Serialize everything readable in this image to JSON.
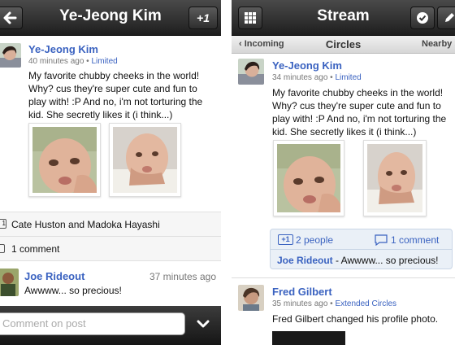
{
  "left": {
    "header": {
      "back_label": "",
      "title": "Ye-Jeong Kim",
      "plus_label": "+1"
    },
    "post": {
      "author": "Ye-Jeong Kim",
      "time": "40 minutes ago",
      "separator": " • ",
      "visibility": "Limited",
      "text": "My favorite chubby cheeks in the world! Why? cus they're super cute and fun to play with! :P And no, i'm not torturing the kid. She secretly likes it (i think...)"
    },
    "plus_ones": "Cate Huston and Madoka Hayashi",
    "comments_count": "1 comment",
    "comment": {
      "author": "Joe Rideout",
      "time": "37 minutes ago",
      "text": "Awwww... so precious!"
    },
    "comment_placeholder": "Comment on post"
  },
  "right": {
    "header": {
      "title": "Stream"
    },
    "subbar": {
      "incoming": "‹ Incoming",
      "circles": "Circles",
      "nearby": "Nearby ›"
    },
    "post": {
      "author": "Ye-Jeong Kim",
      "time": "34 minutes ago",
      "separator": " • ",
      "visibility": "Limited",
      "text": "My favorite chubby cheeks in the world! Why? cus they're super cute and fun to play with! :P And no, i'm not torturing the kid. She secretly likes it (i think...)"
    },
    "engagement": {
      "plus_badge": "+1",
      "people": "2 people",
      "comments": "1 comment",
      "latest_author": "Joe Rideout",
      "latest_text": " - Awwww... so precious!"
    },
    "post2": {
      "author": "Fred Gilbert",
      "time": "35 minutes ago",
      "separator": " • ",
      "visibility": "Extended Circles",
      "text": "Fred Gilbert changed his profile photo."
    }
  },
  "icons": {
    "back": "back-arrow-icon",
    "grid": "grid-icon",
    "check": "check-icon",
    "pencil": "pencil-icon",
    "chevron": "chevron-down-icon",
    "plus_people": "plus-one-icon",
    "comment": "comment-bubble-icon"
  },
  "colors": {
    "link": "#3a62c0",
    "bar_dark": "#1e1e1e"
  }
}
